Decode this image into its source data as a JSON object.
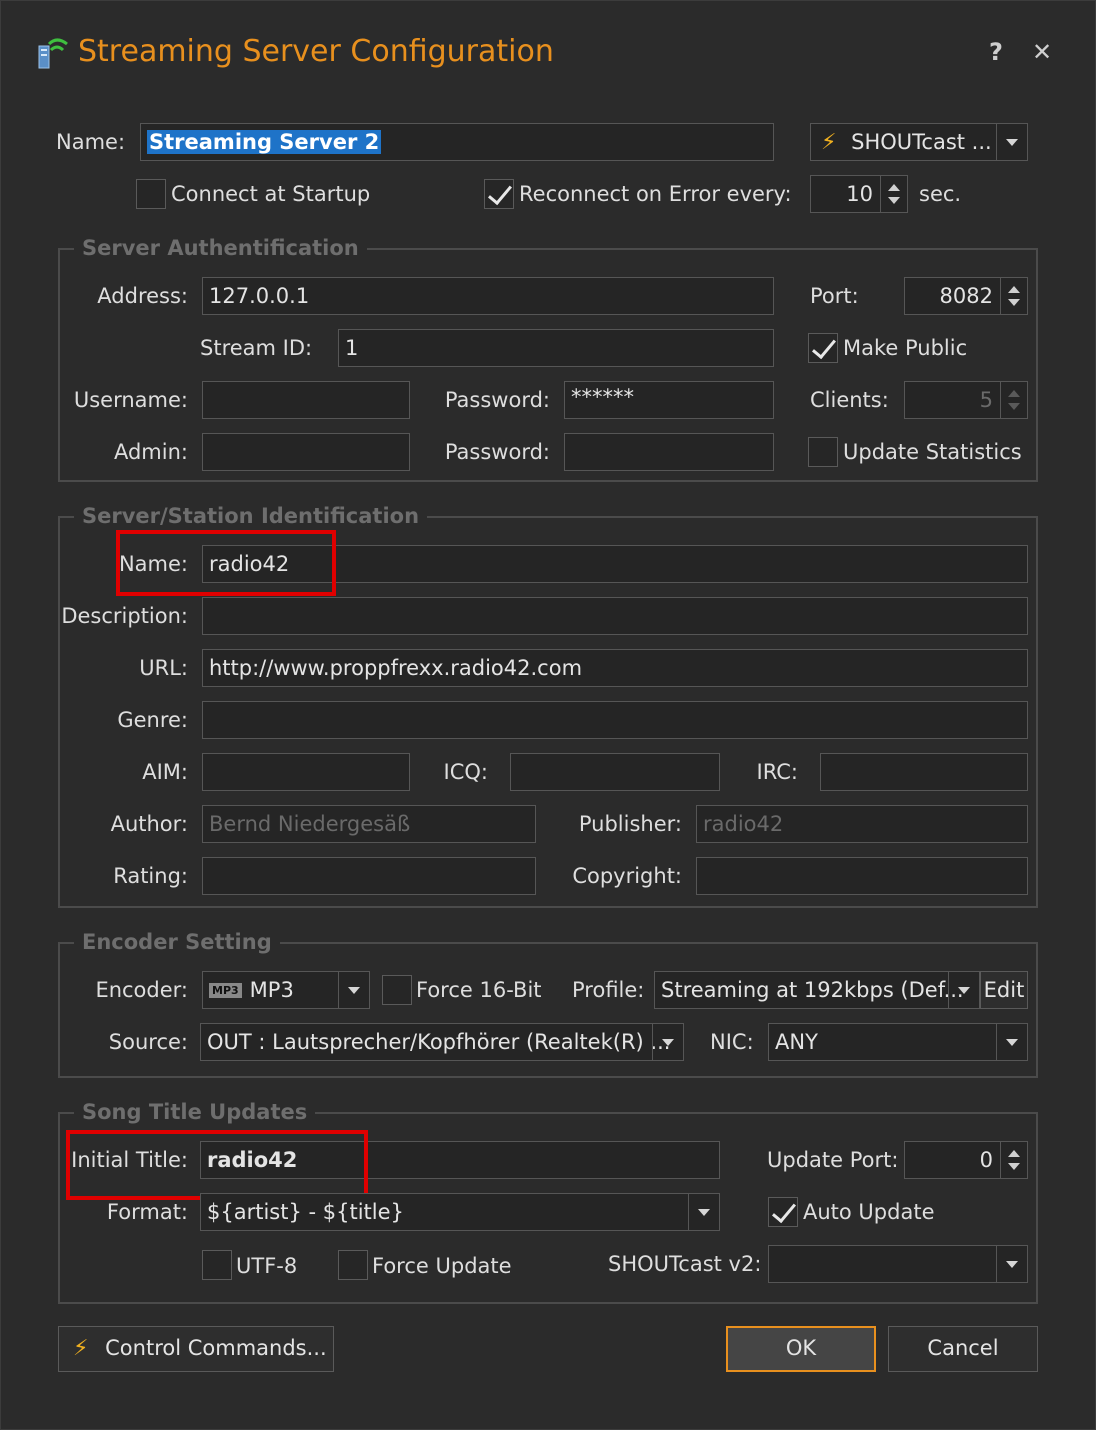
{
  "window": {
    "title": "Streaming Server Configuration",
    "help": "?",
    "close": "✕",
    "accent_color": "#e8901e"
  },
  "top": {
    "name_label": "Name:",
    "name_value": "Streaming Server 2",
    "server_type": "SHOUTcast ...",
    "connect_label": "Connect at Startup",
    "connect_checked": false,
    "reconnect_label": "Reconnect on Error every:",
    "reconnect_checked": true,
    "reconnect_value": "10",
    "sec_label": "sec."
  },
  "auth": {
    "legend": "Server Authentification",
    "address_label": "Address:",
    "address_value": "127.0.0.1",
    "port_label": "Port:",
    "port_value": "8082",
    "stream_id_label": "Stream ID:",
    "stream_id_value": "1",
    "make_public_label": "Make Public",
    "make_public_checked": true,
    "username_label": "Username:",
    "username_value": "",
    "password_label": "Password:",
    "password_value": "******",
    "clients_label": "Clients:",
    "clients_value": "5",
    "admin_label": "Admin:",
    "admin_value": "",
    "admin_password_label": "Password:",
    "admin_password_value": "",
    "update_stats_label": "Update Statistics",
    "update_stats_checked": false
  },
  "ident": {
    "legend": "Server/Station Identification",
    "name_label": "Name:",
    "name_value": "radio42",
    "description_label": "Description:",
    "description_value": "",
    "url_label": "URL:",
    "url_value": "http://www.proppfrexx.radio42.com",
    "genre_label": "Genre:",
    "genre_value": "",
    "aim_label": "AIM:",
    "aim_value": "",
    "icq_label": "ICQ:",
    "icq_value": "",
    "irc_label": "IRC:",
    "irc_value": "",
    "author_label": "Author:",
    "author_value": "Bernd Niedergesäß",
    "publisher_label": "Publisher:",
    "publisher_value": "radio42",
    "rating_label": "Rating:",
    "rating_value": "",
    "copyright_label": "Copyright:",
    "copyright_value": ""
  },
  "encoder": {
    "legend": "Encoder Setting",
    "encoder_label": "Encoder:",
    "encoder_tag": "MP3",
    "encoder_value": "MP3",
    "force16_label": "Force 16-Bit",
    "force16_checked": false,
    "profile_label": "Profile:",
    "profile_value": "Streaming at 192kbps (Def...",
    "edit_label": "Edit",
    "source_label": "Source:",
    "source_value": "OUT  : Lautsprecher/Kopfhörer (Realtek(R) ...",
    "nic_label": "NIC:",
    "nic_value": "ANY"
  },
  "song": {
    "legend": "Song Title Updates",
    "initial_title_label": "Initial Title:",
    "initial_title_value": "radio42",
    "update_port_label": "Update Port:",
    "update_port_value": "0",
    "format_label": "Format:",
    "format_value": "${artist} - ${title}",
    "auto_update_label": "Auto Update",
    "auto_update_checked": true,
    "utf8_label": "UTF-8",
    "utf8_checked": false,
    "force_update_label": "Force Update",
    "force_update_checked": false,
    "shoutcast_v2_label": "SHOUTcast v2:",
    "shoutcast_v2_value": ""
  },
  "footer": {
    "control_commands_label": "Control Commands...",
    "ok_label": "OK",
    "cancel_label": "Cancel"
  },
  "annotation_color": "#e00000"
}
